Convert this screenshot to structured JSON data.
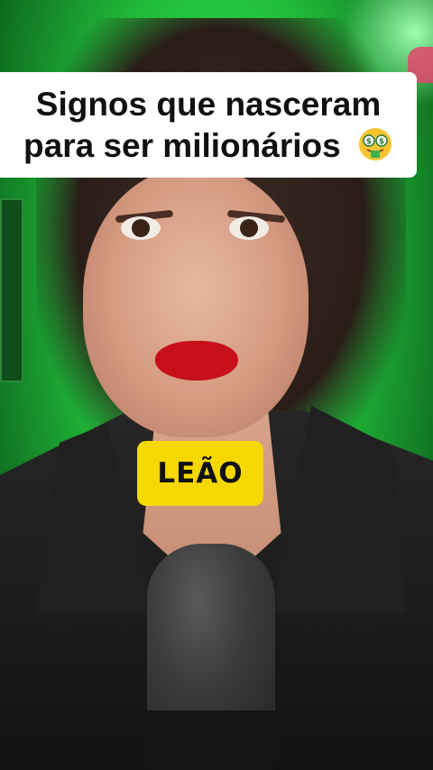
{
  "caption": {
    "line1": "Signos que nasceram",
    "line2": "para ser milionários",
    "emoji": "money-mouth-face-icon"
  },
  "sign_tag": {
    "label": "LEÃO",
    "color": "#f5d800"
  },
  "colors": {
    "background_green": "#22c23c",
    "lips_red": "#c8101c"
  }
}
